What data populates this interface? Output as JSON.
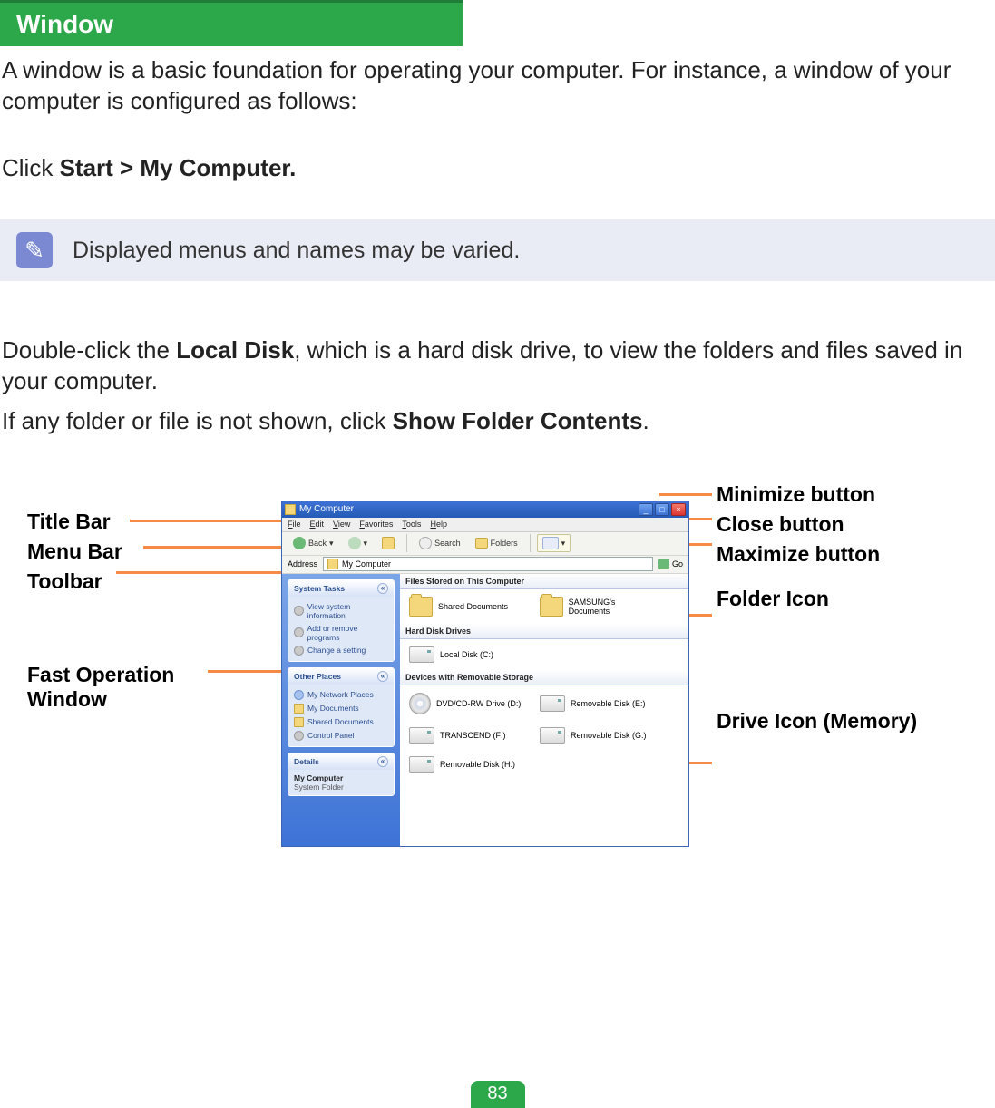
{
  "section_title": "Window",
  "intro1": "A window is a basic foundation for operating your computer. For instance, a window of your computer is configured as follows:",
  "instr_prefix": "Click ",
  "instr_bold": "Start > My Computer.",
  "note_text": "Displayed menus and names may be varied.",
  "para2_a": "Double-click the ",
  "para2_b": "Local Disk",
  "para2_c": ", which is a hard disk drive, to view the folders and files saved in your computer.",
  "para3_a": "If any folder or file is not shown, click ",
  "para3_b": "Show Folder Contents",
  "para3_c": ".",
  "left_labels": {
    "title_bar": "Title Bar",
    "menu_bar": "Menu Bar",
    "toolbar": "Toolbar",
    "fast_op": "Fast Operation\nWindow"
  },
  "right_labels": {
    "minimize": "Minimize button",
    "close": "Close button",
    "maximize": "Maximize button",
    "folder_icon": "Folder Icon",
    "drive_icon": "Drive Icon (Memory)"
  },
  "mock": {
    "title": "My Computer",
    "menu": [
      "File",
      "Edit",
      "View",
      "Favorites",
      "Tools",
      "Help"
    ],
    "tool_back": "Back",
    "tool_search": "Search",
    "tool_folders": "Folders",
    "addr_label": "Address",
    "addr_value": "My Computer",
    "go": "Go",
    "side_tasks_hdr": "System Tasks",
    "side_tasks": [
      "View system information",
      "Add or remove programs",
      "Change a setting"
    ],
    "side_places_hdr": "Other Places",
    "side_places": [
      "My Network Places",
      "My Documents",
      "Shared Documents",
      "Control Panel"
    ],
    "side_details_hdr": "Details",
    "side_details_name": "My Computer",
    "side_details_type": "System Folder",
    "cat_files": "Files Stored on This Computer",
    "folders": [
      "Shared Documents",
      "SAMSUNG's Documents"
    ],
    "cat_hdd": "Hard Disk Drives",
    "hdds": [
      "Local Disk (C:)"
    ],
    "cat_rem": "Devices with Removable Storage",
    "removables": [
      "DVD/CD-RW Drive (D:)",
      "Removable Disk (E:)",
      "TRANSCEND (F:)",
      "Removable Disk (G:)",
      "Removable Disk (H:)"
    ]
  },
  "page_number": "83"
}
